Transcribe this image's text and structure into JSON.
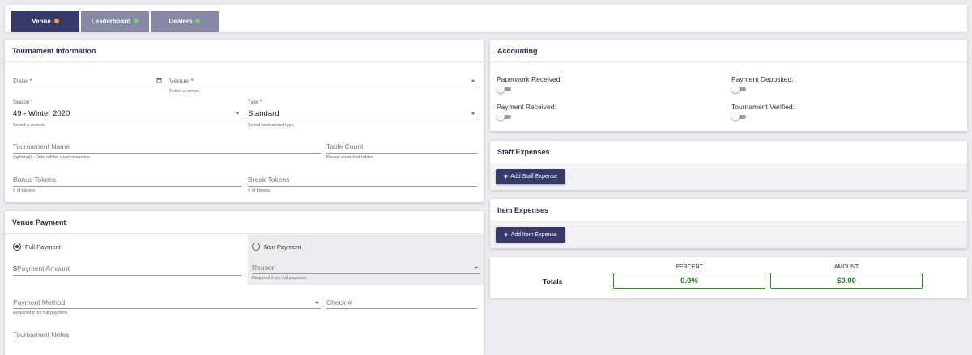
{
  "tabs": [
    {
      "label": "Venue",
      "status_color": "#f0a020",
      "active": true
    },
    {
      "label": "Leaderboard",
      "status_color": "#7cc87c",
      "active": false
    },
    {
      "label": "Dealers",
      "status_color": "#7cc87c",
      "active": false
    }
  ],
  "tournament_info": {
    "title": "Tournament Information",
    "date": {
      "placeholder": "Date *"
    },
    "venue": {
      "placeholder": "Venue *",
      "hint": "Select a venue."
    },
    "season": {
      "label": "Season *",
      "value": "49 - Winter 2020",
      "hint": "Select a season."
    },
    "type": {
      "label": "Type *",
      "value": "Standard",
      "hint": "Select tournament type."
    },
    "tournament_name": {
      "placeholder": "Tournament Name",
      "hint": "(optional) - Date will be used otherwise."
    },
    "table_count": {
      "placeholder": "Table Count",
      "hint": "Please enter # of tables."
    },
    "bonus_tokens": {
      "placeholder": "Bonus Tokens",
      "hint": "# of tokens."
    },
    "break_tokens": {
      "placeholder": "Break Tokens",
      "hint": "# of tokens."
    }
  },
  "venue_payment": {
    "title": "Venue Payment",
    "full_payment_label": "Full Payment",
    "non_payment_label": "Non Payment",
    "payment_amount": {
      "prefix": "$",
      "placeholder": "Payment Amount"
    },
    "reason": {
      "placeholder": "Reason",
      "hint": "Required if not full payment."
    },
    "payment_method": {
      "placeholder": "Payment Method",
      "hint": "Required if not full payment."
    },
    "check": {
      "placeholder": "Check #"
    },
    "notes": {
      "placeholder": "Tournament Notes"
    }
  },
  "accounting": {
    "title": "Accounting",
    "paperwork_received": "Paperwork Received:",
    "payment_deposited": "Payment Deposited:",
    "payment_received": "Payment Received:",
    "tournament_verified": "Tournament Verified:"
  },
  "staff_expenses": {
    "title": "Staff Expenses",
    "button": "Add Staff Expense"
  },
  "item_expenses": {
    "title": "Item Expenses",
    "button": "Add Item Expense"
  },
  "totals": {
    "label": "Totals",
    "percent_header": "PERCENT",
    "amount_header": "AMOUNT",
    "percent_value": "0.0%",
    "amount_value": "$0.00"
  }
}
